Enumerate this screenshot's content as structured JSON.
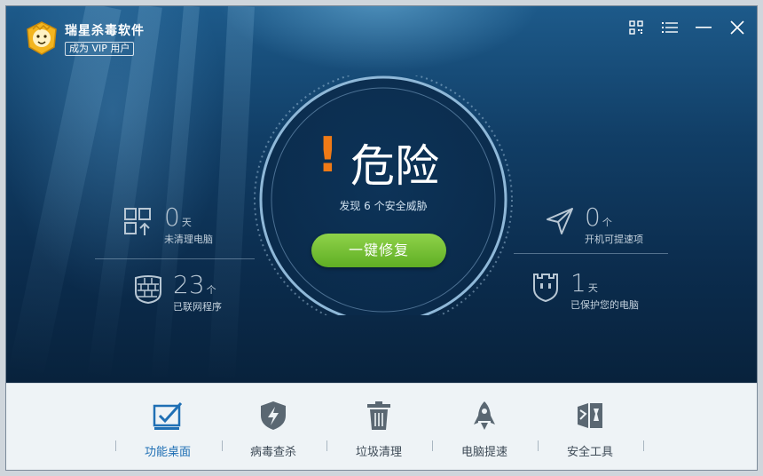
{
  "app": {
    "title": "瑞星杀毒软件",
    "vip_label": "成为 VIP 用户"
  },
  "status": {
    "bang": "!",
    "word": "危险",
    "threat_text": "发现 6 个安全威胁",
    "fix_label": "一键修复"
  },
  "stats": {
    "uncleaned": {
      "value": "0",
      "unit": "天",
      "label": "未清理电脑"
    },
    "networked": {
      "value": "23",
      "unit": "个",
      "label": "已联网程序"
    },
    "startup": {
      "value": "0",
      "unit": "个",
      "label": "开机可提速项"
    },
    "protected": {
      "value": "1",
      "unit": "天",
      "label": "已保护您的电脑"
    }
  },
  "nav": [
    {
      "label": "功能桌面",
      "icon": "desktop-check-icon",
      "active": true
    },
    {
      "label": "病毒查杀",
      "icon": "shield-bolt-icon",
      "active": false
    },
    {
      "label": "垃圾清理",
      "icon": "trash-icon",
      "active": false
    },
    {
      "label": "电脑提速",
      "icon": "rocket-icon",
      "active": false
    },
    {
      "label": "安全工具",
      "icon": "toolbox-icon",
      "active": false
    }
  ],
  "colors": {
    "accent": "#1f6fb4",
    "danger": "#f07a16",
    "fix_button": "#6dbb2c"
  }
}
